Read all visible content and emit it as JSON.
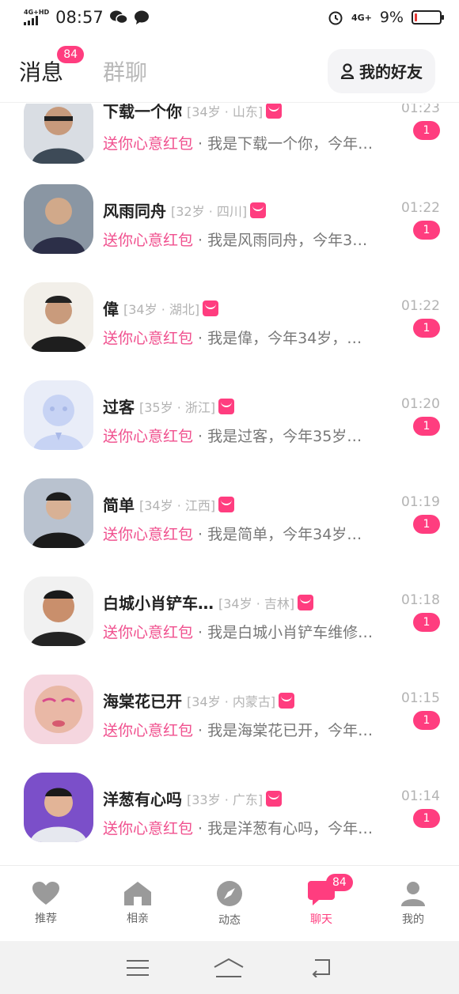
{
  "status_bar": {
    "network_label": "4G+HD",
    "time": "08:57",
    "right_network": "4G+",
    "battery_percent": "9%",
    "battery_level": 0.09,
    "battery_color": "#e53935",
    "icons": [
      "signal-icon",
      "wechat-icon",
      "message-icon",
      "alarm-icon",
      "battery-icon"
    ]
  },
  "header": {
    "tabs": [
      {
        "label": "消息",
        "badge": "84",
        "active": true
      },
      {
        "label": "群聊",
        "active": false
      }
    ],
    "friends_button": {
      "label": "我的好友",
      "icon": "person-icon"
    }
  },
  "conversations": [
    {
      "name": "下载一个你",
      "meta": "[34岁 · 山东]",
      "gift_label": "送你心意红包",
      "message": " · 我是下载一个你，今年…",
      "time": "01:23",
      "unread": "1"
    },
    {
      "name": "风雨同舟",
      "meta": "[32岁 · 四川]",
      "gift_label": "送你心意红包",
      "message": " · 我是风雨同舟，今年3…",
      "time": "01:22",
      "unread": "1"
    },
    {
      "name": "偉",
      "meta": "[34岁 · 湖北]",
      "gift_label": "送你心意红包",
      "message": " · 我是偉，今年34岁，…",
      "time": "01:22",
      "unread": "1"
    },
    {
      "name": "过客",
      "meta": "[35岁 · 浙江]",
      "gift_label": "送你心意红包",
      "message": " · 我是过客，今年35岁…",
      "time": "01:20",
      "unread": "1"
    },
    {
      "name": "简单",
      "meta": "[34岁 · 江西]",
      "gift_label": "送你心意红包",
      "message": " · 我是简单，今年34岁…",
      "time": "01:19",
      "unread": "1"
    },
    {
      "name": "白城小肖铲车…",
      "meta": "[34岁 · 吉林]",
      "gift_label": "送你心意红包",
      "message": " · 我是白城小肖铲车维修…",
      "time": "01:18",
      "unread": "1"
    },
    {
      "name": "海棠花已开",
      "meta": "[34岁 · 内蒙古]",
      "gift_label": "送你心意红包",
      "message": " · 我是海棠花已开，今年…",
      "time": "01:15",
      "unread": "1"
    },
    {
      "name": "洋葱有心吗",
      "meta": "[33岁 · 广东]",
      "gift_label": "送你心意红包",
      "message": " · 我是洋葱有心吗，今年…",
      "time": "01:14",
      "unread": "1"
    }
  ],
  "bottom_nav": {
    "items": [
      {
        "label": "推荐",
        "icon": "heart-icon"
      },
      {
        "label": "相亲",
        "icon": "home-icon"
      },
      {
        "label": "动态",
        "icon": "compass-icon"
      },
      {
        "label": "聊天",
        "icon": "chat-icon",
        "badge": "84",
        "active": true
      },
      {
        "label": "我的",
        "icon": "profile-icon"
      }
    ]
  },
  "colors": {
    "accent": "#ff3d7f",
    "gift_text": "#f0508e",
    "muted": "#b3b3b3"
  }
}
